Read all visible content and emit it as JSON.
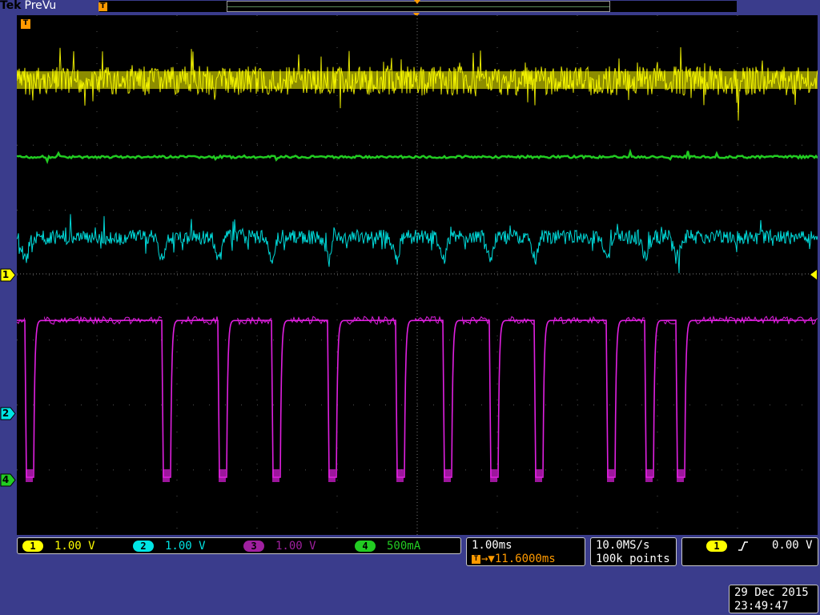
{
  "brand": {
    "name": "Tek",
    "mode": "PreVu"
  },
  "colors": {
    "ch1": "#ffff00",
    "ch2": "#00e5e5",
    "ch3": "#e020e0",
    "ch4": "#22cc22",
    "trigger": "#ff9a00",
    "background": "#3a3c8c"
  },
  "channel_markers": [
    {
      "id": "1",
      "color": "#ffff00"
    },
    {
      "id": "2",
      "color": "#00e5e5"
    },
    {
      "id": "4",
      "color": "#22cc22"
    }
  ],
  "trigger_marker": "T",
  "channels": [
    {
      "id": "1",
      "scale": "1.00 V",
      "color": "#ffff00"
    },
    {
      "id": "2",
      "scale": "1.00 V",
      "color": "#00e5e5"
    },
    {
      "id": "3",
      "scale": "1.00 V",
      "color": "#e020e0"
    },
    {
      "id": "4",
      "scale": "500mA",
      "color": "#22cc22"
    }
  ],
  "timebase": {
    "scale": "1.00ms",
    "position": "→▼11.6000ms"
  },
  "acquisition": {
    "sample_rate": "10.0MS/s",
    "record_length": "100k points"
  },
  "trigger": {
    "source": "1",
    "slope_icon": "rising-edge-icon",
    "level": "0.00 V"
  },
  "datetime": {
    "date": "29 Dec 2015",
    "time": "23:49:47"
  }
}
